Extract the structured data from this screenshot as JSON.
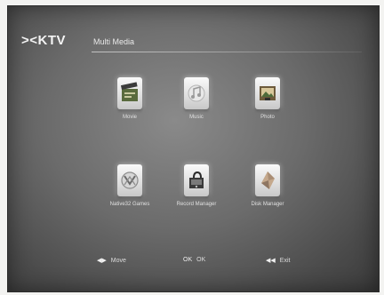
{
  "header": {
    "logo": "KTV",
    "title": "Multi Media"
  },
  "tiles": [
    {
      "label": "Movie"
    },
    {
      "label": "Music"
    },
    {
      "label": "Photo"
    },
    {
      "label": "Native32 Games"
    },
    {
      "label": "Record Manager"
    },
    {
      "label": "Disk Manager"
    }
  ],
  "hints": {
    "move": {
      "key": "◀▶",
      "label": "Move"
    },
    "ok": {
      "key": "OK",
      "label": "OK"
    },
    "exit": {
      "key": "◀◀",
      "label": "Exit"
    }
  }
}
